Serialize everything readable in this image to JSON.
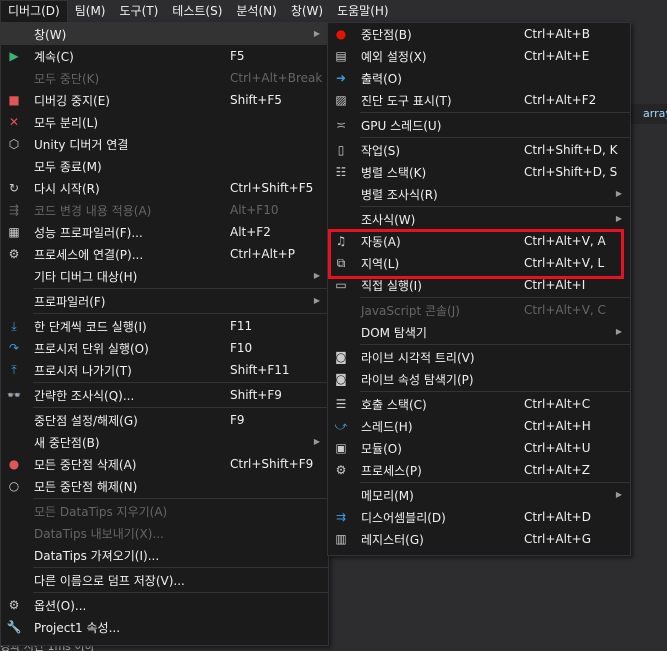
{
  "menubar": {
    "items": [
      "디버그(D)",
      "팀(M)",
      "도구(T)",
      "테스트(S)",
      "분석(N)",
      "창(W)",
      "도움말(H)"
    ]
  },
  "debug_menu": {
    "items": [
      {
        "label": "창(W)",
        "shortcut": "",
        "icon": "",
        "submenu": true,
        "highlighted": true
      },
      {
        "label": "계속(C)",
        "shortcut": "F5",
        "icon": "continue-play-icon"
      },
      {
        "label": "모두 중단(K)",
        "shortcut": "Ctrl+Alt+Break",
        "icon": "",
        "disabled": true
      },
      {
        "label": "디버깅 중지(E)",
        "shortcut": "Shift+F5",
        "icon": "stop-icon"
      },
      {
        "label": "모두 분리(L)",
        "shortcut": "",
        "icon": "detach-icon"
      },
      {
        "label": "Unity 디버거 연결",
        "shortcut": "",
        "icon": "unity-icon"
      },
      {
        "label": "모두 종료(M)",
        "shortcut": "",
        "icon": ""
      },
      {
        "label": "다시 시작(R)",
        "shortcut": "Ctrl+Shift+F5",
        "icon": "restart-icon"
      },
      {
        "label": "코드 변경 내용 적용(A)",
        "shortcut": "Alt+F10",
        "icon": "apply-changes-icon",
        "disabled": true
      },
      {
        "label": "성능 프로파일러(F)...",
        "shortcut": "Alt+F2",
        "icon": "profiler-icon"
      },
      {
        "label": "프로세스에 연결(P)...",
        "shortcut": "Ctrl+Alt+P",
        "icon": "attach-process-icon"
      },
      {
        "label": "기타 디버그 대상(H)",
        "shortcut": "",
        "icon": "",
        "submenu": true
      },
      {
        "sep": true
      },
      {
        "label": "프로파일러(F)",
        "shortcut": "",
        "icon": "",
        "submenu": true
      },
      {
        "sep": true
      },
      {
        "label": "한 단계씩 코드 실행(I)",
        "shortcut": "F11",
        "icon": "step-into-icon"
      },
      {
        "label": "프로시저 단위 실행(O)",
        "shortcut": "F10",
        "icon": "step-over-icon"
      },
      {
        "label": "프로시저 나가기(T)",
        "shortcut": "Shift+F11",
        "icon": "step-out-icon"
      },
      {
        "sep": true
      },
      {
        "label": "간략한 조사식(Q)...",
        "shortcut": "Shift+F9",
        "icon": "quick-watch-icon"
      },
      {
        "sep": true
      },
      {
        "label": "중단점 설정/해제(G)",
        "shortcut": "F9",
        "icon": ""
      },
      {
        "label": "새 중단점(B)",
        "shortcut": "",
        "icon": "",
        "submenu": true
      },
      {
        "label": "모든 중단점 삭제(A)",
        "shortcut": "Ctrl+Shift+F9",
        "icon": "delete-breakpoints-icon"
      },
      {
        "label": "모든 중단점 해제(N)",
        "shortcut": "",
        "icon": "disable-breakpoints-icon"
      },
      {
        "sep": true
      },
      {
        "label": "모든 DataTips 지우기(A)",
        "shortcut": "",
        "icon": "",
        "disabled": true
      },
      {
        "label": "DataTips 내보내기(X)...",
        "shortcut": "",
        "icon": "",
        "disabled": true
      },
      {
        "label": "DataTips 가져오기(I)...",
        "shortcut": "",
        "icon": ""
      },
      {
        "sep": true
      },
      {
        "label": "다른 이름으로 덤프 저장(V)...",
        "shortcut": "",
        "icon": ""
      },
      {
        "sep": true
      },
      {
        "label": "옵션(O)...",
        "shortcut": "",
        "icon": "gear-icon"
      },
      {
        "label": "Project1 속성...",
        "shortcut": "",
        "icon": "wrench-icon"
      }
    ]
  },
  "window_submenu": {
    "items": [
      {
        "label": "중단점(B)",
        "shortcut": "Ctrl+Alt+B",
        "icon": "breakpoints-icon"
      },
      {
        "label": "예외 설정(X)",
        "shortcut": "Ctrl+Alt+E",
        "icon": "exception-settings-icon"
      },
      {
        "label": "출력(O)",
        "shortcut": "",
        "icon": "output-icon"
      },
      {
        "label": "진단 도구 표시(T)",
        "shortcut": "Ctrl+Alt+F2",
        "icon": "diagnostic-tools-icon"
      },
      {
        "sep": true
      },
      {
        "label": "GPU 스레드(U)",
        "shortcut": "",
        "icon": "gpu-threads-icon"
      },
      {
        "sep": true
      },
      {
        "label": "작업(S)",
        "shortcut": "Ctrl+Shift+D, K",
        "icon": "tasks-icon"
      },
      {
        "label": "병렬 스택(K)",
        "shortcut": "Ctrl+Shift+D, S",
        "icon": "parallel-stacks-icon"
      },
      {
        "label": "병렬 조사식(R)",
        "shortcut": "",
        "icon": "",
        "submenu": true
      },
      {
        "sep": true
      },
      {
        "label": "조사식(W)",
        "shortcut": "",
        "icon": "",
        "submenu": true
      },
      {
        "label": "자동(A)",
        "shortcut": "Ctrl+Alt+V, A",
        "icon": "autos-icon"
      },
      {
        "label": "지역(L)",
        "shortcut": "Ctrl+Alt+V, L",
        "icon": "locals-icon"
      },
      {
        "label": "직접 실행(I)",
        "shortcut": "Ctrl+Alt+I",
        "icon": "immediate-icon"
      },
      {
        "sep": true
      },
      {
        "label": "JavaScript 콘솔(J)",
        "shortcut": "Ctrl+Alt+V, C",
        "icon": "",
        "disabled": true
      },
      {
        "label": "DOM 탐색기",
        "shortcut": "",
        "icon": "",
        "submenu": true
      },
      {
        "sep": true
      },
      {
        "label": "라이브 시각적 트리(V)",
        "shortcut": "",
        "icon": "live-visual-tree-icon"
      },
      {
        "label": "라이브 속성 탐색기(P)",
        "shortcut": "",
        "icon": "live-property-icon"
      },
      {
        "sep": true
      },
      {
        "label": "호출 스택(C)",
        "shortcut": "Ctrl+Alt+C",
        "icon": "call-stack-icon"
      },
      {
        "label": "스레드(H)",
        "shortcut": "Ctrl+Alt+H",
        "icon": "threads-icon"
      },
      {
        "label": "모듈(O)",
        "shortcut": "Ctrl+Alt+U",
        "icon": "modules-icon"
      },
      {
        "label": "프로세스(P)",
        "shortcut": "Ctrl+Alt+Z",
        "icon": "processes-icon"
      },
      {
        "sep": true
      },
      {
        "label": "메모리(M)",
        "shortcut": "",
        "icon": "",
        "submenu": true
      },
      {
        "label": "디스어셈블리(D)",
        "shortcut": "Ctrl+Alt+D",
        "icon": "disassembly-icon"
      },
      {
        "label": "레지스터(G)",
        "shortcut": "Ctrl+Alt+G",
        "icon": "registers-icon"
      }
    ]
  },
  "background": {
    "tab_text": "array",
    "bottom_text": "경과 시간 1ms 이하"
  },
  "colors": {
    "highlight_box": "#e81123",
    "menu_bg": "#1b1b1c",
    "menubar_bg": "#2d2d30"
  }
}
